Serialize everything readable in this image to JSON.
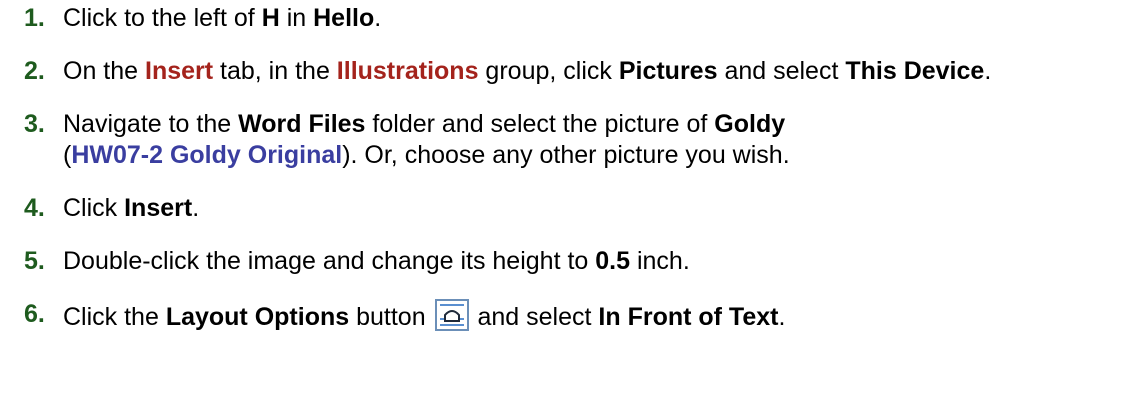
{
  "steps": [
    {
      "num": "1.",
      "parts": {
        "t1": "Click to the left of ",
        "b1": "H",
        "t2": " in ",
        "b2": "Hello",
        "t3": "."
      }
    },
    {
      "num": "2.",
      "parts": {
        "t1": "On the ",
        "r1": "Insert",
        "t2": " tab, in the ",
        "r2": "Illustrations",
        "t3": " group, click ",
        "b1": "Pictures",
        "t4": " and select ",
        "b2": "This Device",
        "t5": "."
      }
    },
    {
      "num": "3.",
      "parts": {
        "t1": "Navigate to the ",
        "b1": "Word Files",
        "t2": " folder and select the picture of ",
        "b2": "Goldy",
        "t3": "(",
        "u1": "HW07-2 Goldy Original",
        "t4": "). Or, choose any other picture you wish."
      }
    },
    {
      "num": "4.",
      "parts": {
        "t1": "Click ",
        "b1": "Insert",
        "t2": "."
      }
    },
    {
      "num": "5.",
      "parts": {
        "t1": "Double-click the image and change its height to ",
        "b1": "0.5",
        "t2": " inch."
      }
    },
    {
      "num": "6.",
      "parts": {
        "t1": "Click the ",
        "b1": "Layout Options",
        "t2": " button ",
        "icon": "layout-options-icon",
        "t3": " and select ",
        "b2": "In Front of Text",
        "t4": "."
      }
    }
  ],
  "colors": {
    "step_number": "#1e5b1e",
    "ribbon_term": "#a4231c",
    "file_name": "#3a3ea0",
    "icon_border": "#6b8fb8"
  }
}
